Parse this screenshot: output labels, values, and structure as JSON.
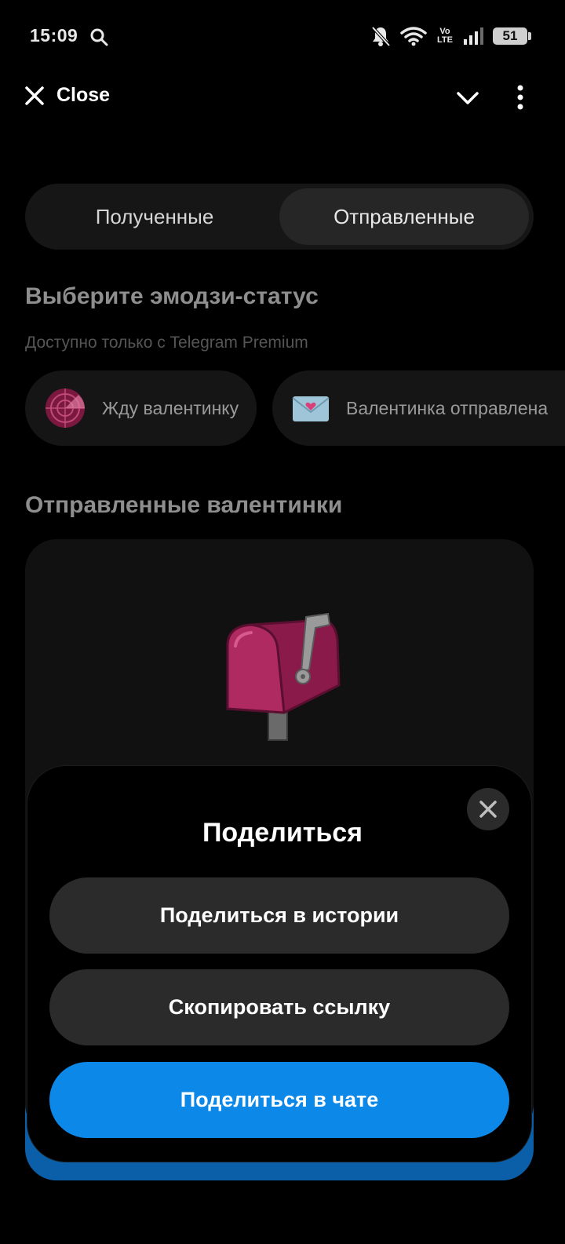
{
  "status_bar": {
    "time": "15:09",
    "volte_top": "Vo",
    "volte_bottom": "LTE",
    "battery": "51"
  },
  "top_bar": {
    "close_label": "Close"
  },
  "tabs": [
    {
      "label": "Полученные"
    },
    {
      "label": "Отправленные",
      "selected": true
    }
  ],
  "emoji_status": {
    "title": "Выберите эмодзи-статус",
    "subtitle": "Доступно только с Telegram Premium",
    "chips": [
      {
        "label": "Жду валентинку",
        "icon": "radar-icon"
      },
      {
        "label": "Валентинка отправлена",
        "icon": "love-letter-icon"
      }
    ]
  },
  "sent_section": {
    "title": "Отправленные валентинки",
    "icon": "mailbox-icon"
  },
  "share_sheet": {
    "title": "Поделиться",
    "buttons": [
      {
        "label": "Поделиться в истории"
      },
      {
        "label": "Скопировать ссылку"
      },
      {
        "label": "Поделиться в чате"
      }
    ]
  },
  "colors": {
    "background": "#000000",
    "primary_button": "#0b88e8",
    "secondary_button": "#2b2b2b",
    "mailbox": "#8a1a4a"
  }
}
